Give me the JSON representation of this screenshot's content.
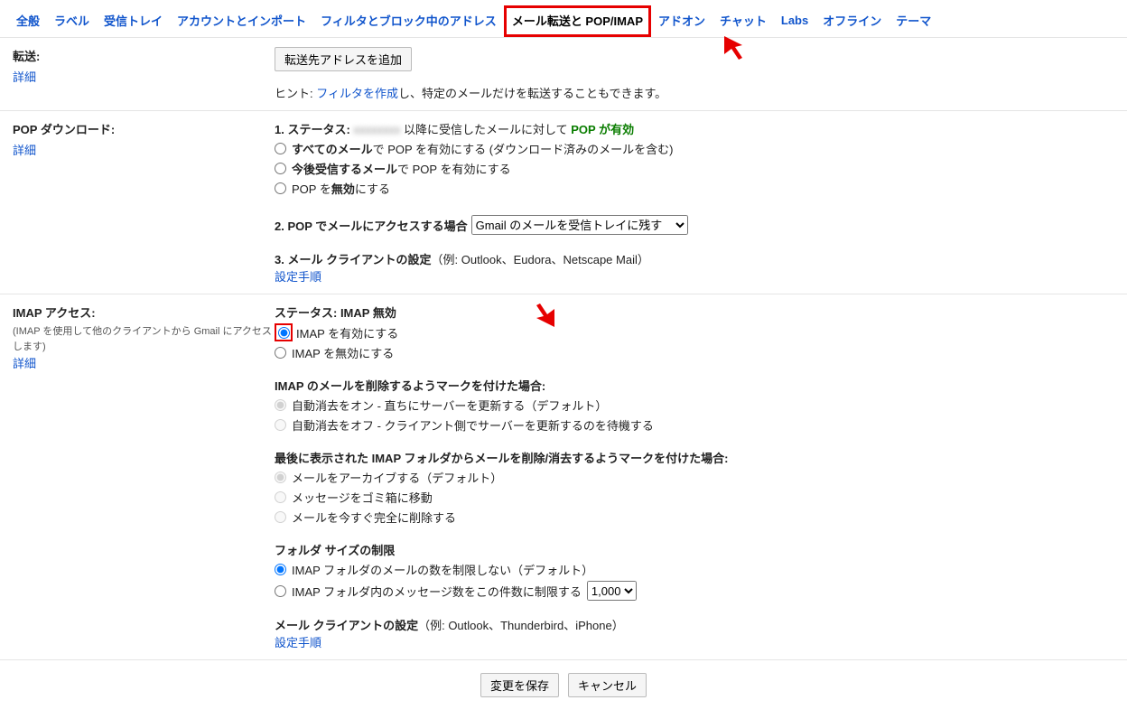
{
  "tabs": {
    "general": "全般",
    "labels": "ラベル",
    "inbox": "受信トレイ",
    "accounts": "アカウントとインポート",
    "filters": "フィルタとブロック中のアドレス",
    "forwarding": "メール転送と POP/IMAP",
    "addons": "アドオン",
    "chat": "チャット",
    "labs": "Labs",
    "offline": "オフライン",
    "themes": "テーマ"
  },
  "forward": {
    "title": "転送:",
    "detail": "詳細",
    "add_button": "転送先アドレスを追加",
    "hint_prefix": "ヒント: ",
    "hint_link": "フィルタを作成",
    "hint_suffix": "し、特定のメールだけを転送することもできます。"
  },
  "pop": {
    "title": "POP ダウンロード:",
    "detail": "詳細",
    "status_prefix": "1. ステータス: ",
    "status_hidden": "xxxxxxxx",
    "status_mid": " 以降に受信したメールに対して ",
    "status_enabled": "POP が有効",
    "opt_all_a": "すべてのメール",
    "opt_all_b": "で POP を有効にする (ダウンロード済みのメールを含む)",
    "opt_now_a": "今後受信するメール",
    "opt_now_b": "で POP を有効にする",
    "opt_disable_a": "POP を",
    "opt_disable_bold": "無効",
    "opt_disable_b": "にする",
    "step2": "2. POP でメールにアクセスする場合 ",
    "select_value": "Gmail のメールを受信トレイに残す",
    "step3": "3. メール クライアントの設定",
    "step3_ex": "（例: Outlook、Eudora、Netscape Mail）",
    "steps_link": "設定手順"
  },
  "imap": {
    "title": "IMAP アクセス:",
    "sub": "(IMAP を使用して他のクライアントから Gmail にアクセスします)",
    "detail": "詳細",
    "status": "ステータス: IMAP 無効",
    "opt_enable": "IMAP を有効にする",
    "opt_disable": "IMAP を無効にする",
    "expunge_title": "IMAP のメールを削除するようマークを付けた場合:",
    "expunge_on": "自動消去をオン - 直ちにサーバーを更新する（デフォルト）",
    "expunge_off": "自動消去をオフ - クライアント側でサーバーを更新するのを待機する",
    "last_title": "最後に表示された IMAP フォルダからメールを削除/消去するようマークを付けた場合:",
    "last_archive": "メールをアーカイブする（デフォルト）",
    "last_trash": "メッセージをゴミ箱に移動",
    "last_delete": "メールを今すぐ完全に削除する",
    "folder_title": "フォルダ サイズの制限",
    "folder_unlimited": "IMAP フォルダのメールの数を制限しない（デフォルト）",
    "folder_limit_label": "IMAP フォルダ内のメッセージ数をこの件数に制限する",
    "folder_limit_value": "1,000",
    "client_title": "メール クライアントの設定",
    "client_ex": "（例: Outlook、Thunderbird、iPhone）",
    "steps_link": "設定手順"
  },
  "footer": {
    "save": "変更を保存",
    "cancel": "キャンセル"
  }
}
